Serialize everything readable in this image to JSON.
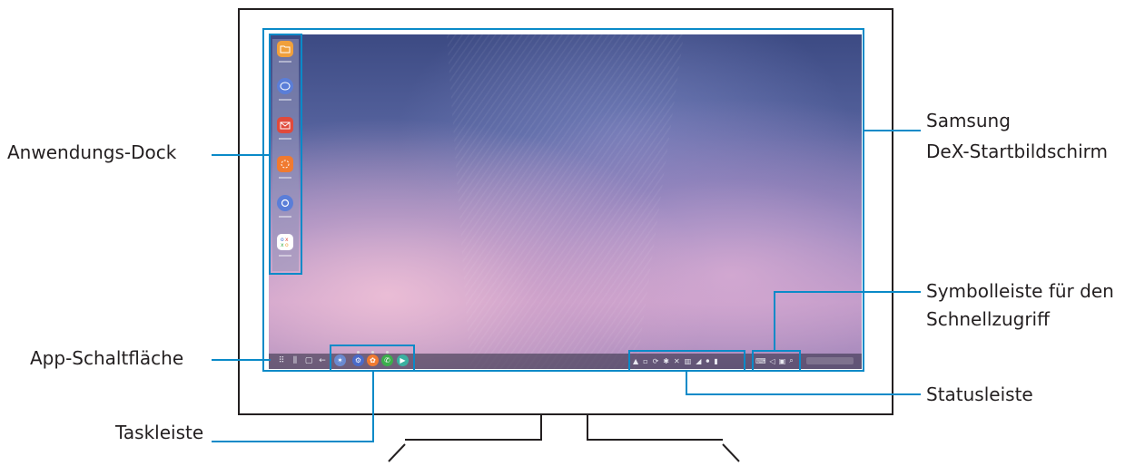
{
  "labels": {
    "dock": "Anwendungs-Dock",
    "app_button": "App-Schaltfläche",
    "taskbar": "Taskleiste",
    "home_line1": "Samsung",
    "home_line2": "DeX-Startbildschirm",
    "quick_line1": "Symbolleiste für den",
    "quick_line2": "Schnellzugriff",
    "statusbar": "Statusleiste"
  },
  "dock_apps": [
    {
      "icon": "folder-icon",
      "color": "#f0a03c"
    },
    {
      "icon": "chat-icon",
      "color": "#5a7ed8"
    },
    {
      "icon": "mail-icon",
      "color": "#e04a3c"
    },
    {
      "icon": "gallery-icon",
      "color": "#f07a30"
    },
    {
      "icon": "settings-icon",
      "color": "#5a7ed8"
    },
    {
      "icon": "game-launcher-icon",
      "color": "#ffffff"
    }
  ],
  "taskbar_apps": [
    {
      "icon": "galaxy-apps-icon",
      "color": "#6a8ad0"
    },
    {
      "icon": "settings-icon",
      "color": "#4a6ac8"
    },
    {
      "icon": "gallery-icon",
      "color": "#f07a30"
    },
    {
      "icon": "phone-icon",
      "color": "#3cae4c"
    },
    {
      "icon": "play-store-icon",
      "color": "#3ab0a0"
    }
  ],
  "accent_color": "#0a8ac8"
}
